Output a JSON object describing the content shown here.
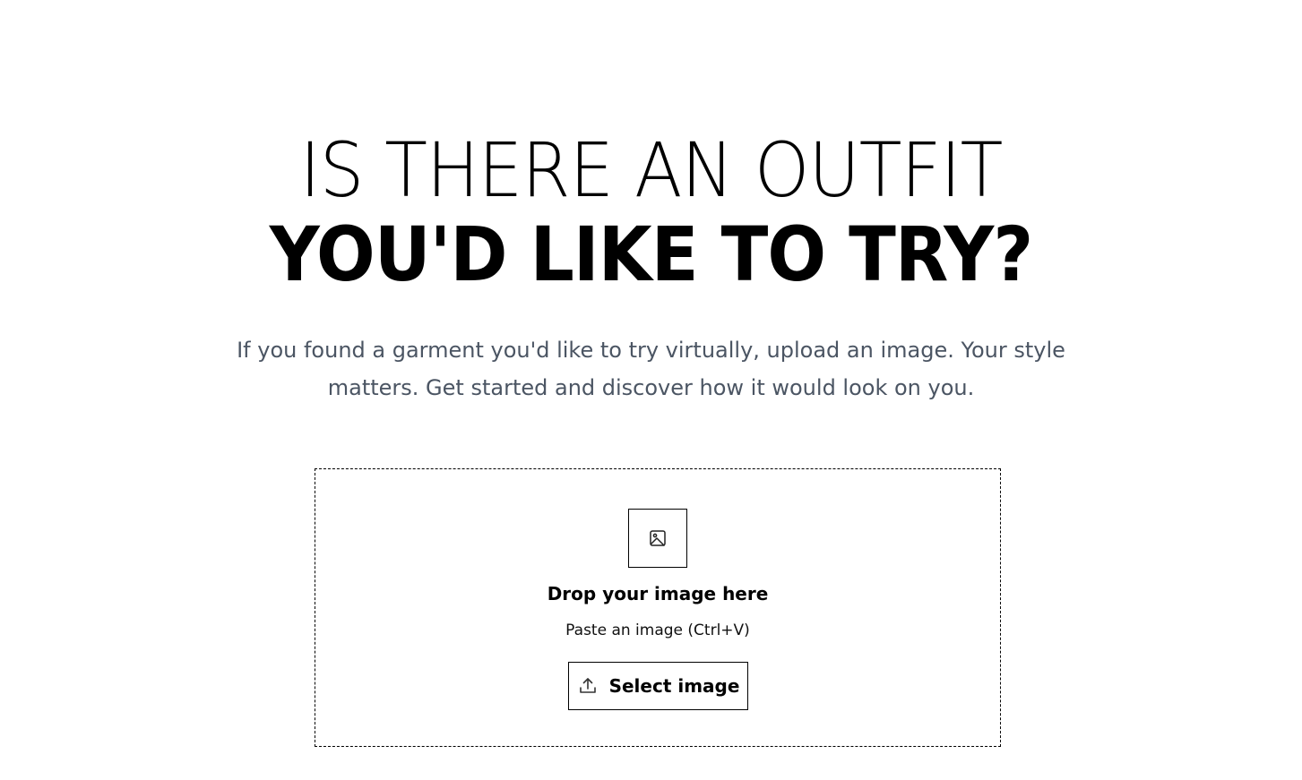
{
  "hero": {
    "title_line_1": "IS THERE AN OUTFIT",
    "title_line_2": "YOU'D LIKE TO TRY?",
    "subtitle_line_1": "If you found a garment you'd like to try virtually, upload an image. Your style",
    "subtitle_line_2": "matters. Get started and discover how it would look on you."
  },
  "upload": {
    "icon": "image-icon",
    "drop_title": "Drop your image here",
    "paste_hint": "Paste an image (Ctrl+V)",
    "button_label": "Select image",
    "button_icon": "upload-icon"
  },
  "colors": {
    "background": "#ffffff",
    "text": "#000000",
    "subtitle": "#4b5563",
    "border": "#000000"
  }
}
